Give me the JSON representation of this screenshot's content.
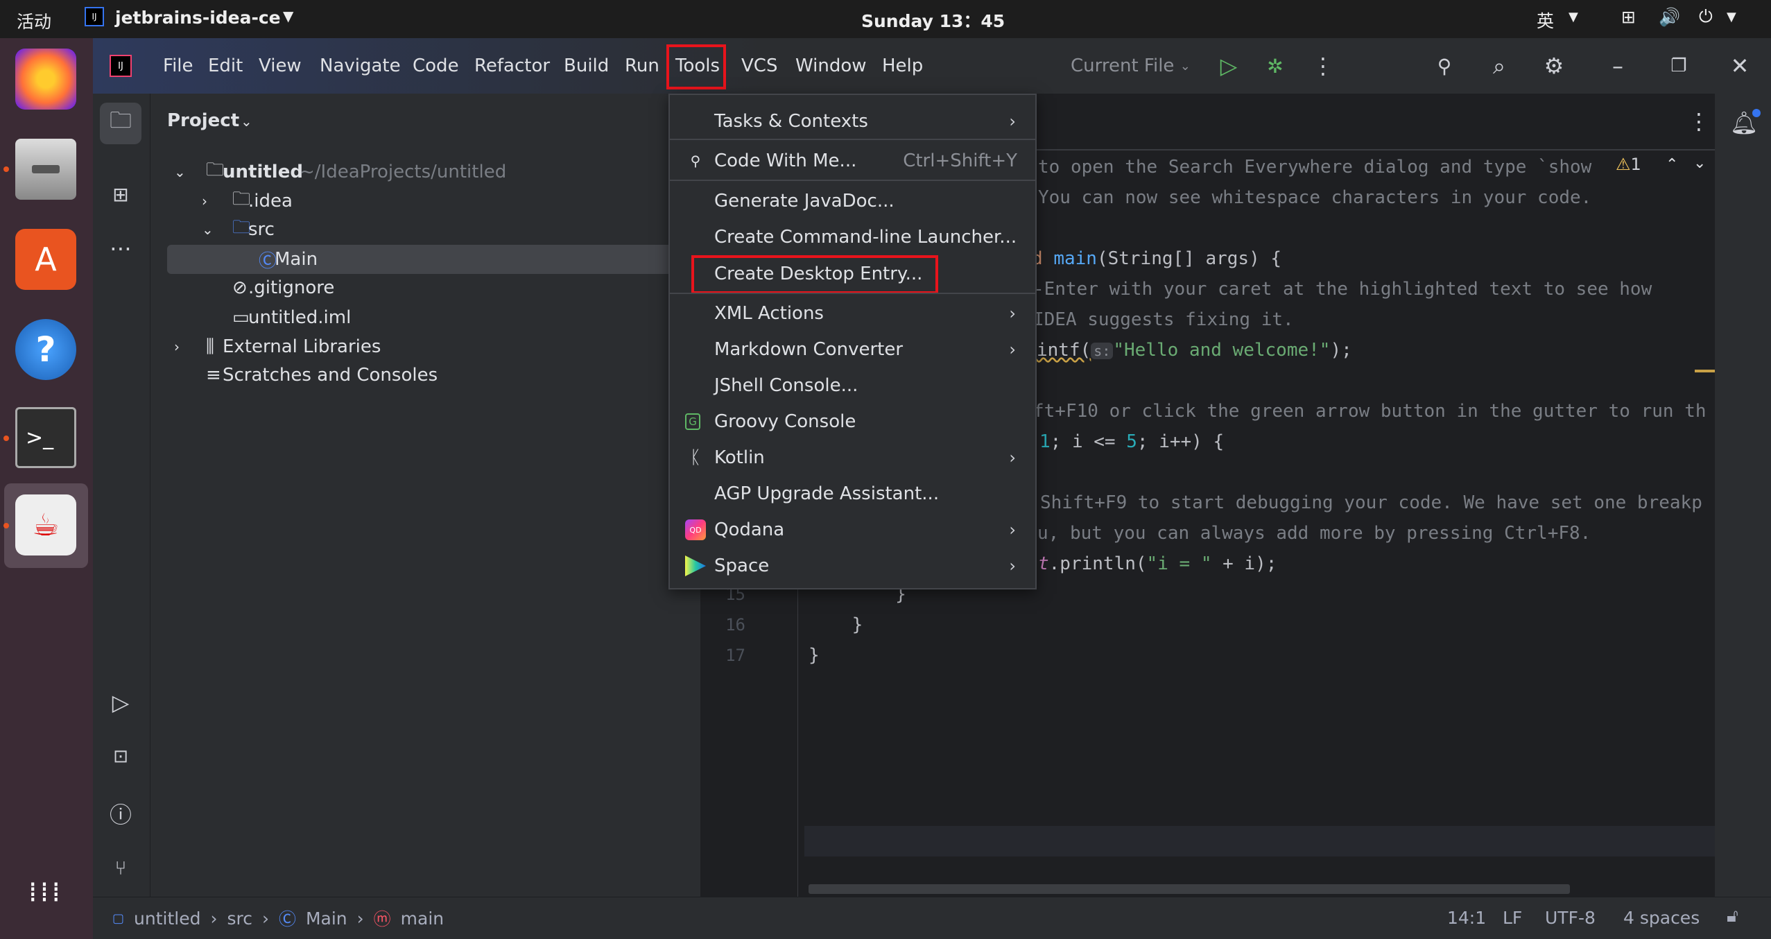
{
  "topbar": {
    "activities": "活动",
    "app_name": "jetbrains-idea-ce",
    "clock": "Sunday 13：45",
    "input_method": "英"
  },
  "dock": {
    "apps": [
      "firefox",
      "files",
      "software",
      "help",
      "terminal",
      "intellij-idea"
    ]
  },
  "menubar": {
    "items": [
      "File",
      "Edit",
      "View",
      "Navigate",
      "Code",
      "Refactor",
      "Build",
      "Run",
      "Tools",
      "VCS",
      "Window",
      "Help"
    ],
    "active": "Tools",
    "run_config": "Current File"
  },
  "project": {
    "title": "Project",
    "tree": [
      {
        "label": "untitled",
        "path": "~/IdeaProjects/untitled"
      },
      {
        "label": ".idea"
      },
      {
        "label": "src"
      },
      {
        "label": "Main"
      },
      {
        "label": ".gitignore"
      },
      {
        "label": "untitled.iml"
      },
      {
        "label": "External Libraries"
      },
      {
        "label": "Scratches and Consoles"
      }
    ]
  },
  "tools_menu": {
    "items": [
      {
        "label": "Tasks & Contexts",
        "submenu": true
      },
      {
        "label": "Code With Me...",
        "shortcut": "Ctrl+Shift+Y"
      },
      {
        "label": "Generate JavaDoc..."
      },
      {
        "label": "Create Command-line Launcher..."
      },
      {
        "label": "Create Desktop Entry...",
        "highlighted": true
      },
      {
        "label": "XML Actions",
        "submenu": true
      },
      {
        "label": "Markdown Converter",
        "submenu": true
      },
      {
        "label": "JShell Console..."
      },
      {
        "label": "Groovy Console"
      },
      {
        "label": "Kotlin",
        "submenu": true
      },
      {
        "label": "AGP Upgrade Assistant..."
      },
      {
        "label": "Qodana",
        "submenu": true
      },
      {
        "label": "Space",
        "submenu": true
      }
    ]
  },
  "editor": {
    "warnings": "1",
    "fragments": {
      "l1": "to open the Search Everywhere dialog and type `show",
      "l2": "You can now see whitespace characters in your code.",
      "l4a": "d ",
      "l4b": "main",
      "l4c": "(String[] args) {",
      "l5": "-Enter with your caret at the highlighted text to see how",
      "l6": "IDEA suggests fixing it.",
      "l7a": "intf(",
      "l7hint": "s:",
      "l7b": "\"Hello and welcome!\"",
      "l7c": ");",
      "l9": "ft+F10 or click the green arrow button in the gutter to run th",
      "l10a": "1",
      "l10b": "; i <= ",
      "l10c": "5",
      "l10d": "; i++) {",
      "l12": "Shift+F9 to start debugging your code. We have set one breakp",
      "l13": "u, but you can always add more by pressing Ctrl+F8.",
      "l14a": "t",
      "l14b": ".println(",
      "l14c": "\"i = \"",
      "l14d": " + i);",
      "l15": "        }",
      "l16": "    }",
      "l17": "}"
    },
    "line_numbers": [
      "15",
      "16",
      "17"
    ]
  },
  "status": {
    "breadcrumb": [
      "untitled",
      "src",
      "Main",
      "main"
    ],
    "position": "14:1",
    "line_sep": "LF",
    "encoding": "UTF-8",
    "indent": "4 spaces"
  },
  "colors": {
    "accent": "#3574f0",
    "highlight_box": "#e8141c",
    "run": "#5fb865"
  }
}
